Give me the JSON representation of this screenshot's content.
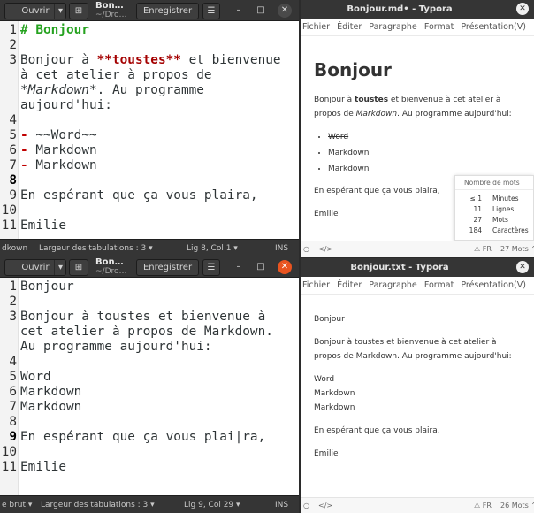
{
  "gedit_top": {
    "open_label": "Ouvrir",
    "title": "Bon…",
    "subtitle": "~/Dro…",
    "save_label": "Enregistrer",
    "lines": [
      {
        "n": "1",
        "segs": [
          {
            "t": "# Bonjour",
            "s": "md-h"
          }
        ]
      },
      {
        "n": "2",
        "segs": []
      },
      {
        "n": "3",
        "segs": [
          {
            "t": "Bonjour à ",
            "s": ""
          },
          {
            "t": "**toustes**",
            "s": "md-b"
          },
          {
            "t": " et bienvenue",
            "s": ""
          }
        ]
      },
      {
        "n": "",
        "segs": [
          {
            "t": "à cet atelier à propos de",
            "s": ""
          }
        ]
      },
      {
        "n": "",
        "segs": [
          {
            "t": "*Markdown*",
            "s": "md-i"
          },
          {
            "t": ". Au programme",
            "s": ""
          }
        ]
      },
      {
        "n": "",
        "segs": [
          {
            "t": "aujourd'hui:",
            "s": ""
          }
        ]
      },
      {
        "n": "4",
        "segs": []
      },
      {
        "n": "5",
        "segs": [
          {
            "t": "-",
            "s": "md-li"
          },
          {
            "t": " ~~Word~~",
            "s": ""
          }
        ]
      },
      {
        "n": "6",
        "segs": [
          {
            "t": "-",
            "s": "md-li"
          },
          {
            "t": " Markdown",
            "s": ""
          }
        ]
      },
      {
        "n": "7",
        "segs": [
          {
            "t": "-",
            "s": "md-li"
          },
          {
            "t": " Markdown",
            "s": ""
          }
        ]
      },
      {
        "n": "8",
        "segs": [],
        "cur": true
      },
      {
        "n": "9",
        "segs": [
          {
            "t": "En espérant que ça vous plaira,",
            "s": ""
          }
        ]
      },
      {
        "n": "10",
        "segs": []
      },
      {
        "n": "11",
        "segs": [
          {
            "t": "Emilie",
            "s": ""
          }
        ]
      }
    ],
    "status_lang": "dkown",
    "status_tabs": "Largeur des tabulations : 3",
    "status_pos": "Lig 8, Col 1",
    "status_ins": "INS"
  },
  "gedit_bot": {
    "open_label": "Ouvrir",
    "title": "Bon…",
    "subtitle": "~/Dro…",
    "save_label": "Enregistrer",
    "lines": [
      {
        "n": "1",
        "segs": [
          {
            "t": "Bonjour",
            "s": ""
          }
        ]
      },
      {
        "n": "2",
        "segs": []
      },
      {
        "n": "3",
        "segs": [
          {
            "t": "Bonjour à toustes et bienvenue à",
            "s": ""
          }
        ]
      },
      {
        "n": "",
        "segs": [
          {
            "t": "cet atelier à propos de Markdown.",
            "s": ""
          }
        ]
      },
      {
        "n": "",
        "segs": [
          {
            "t": "Au programme aujourd'hui:",
            "s": ""
          }
        ]
      },
      {
        "n": "4",
        "segs": []
      },
      {
        "n": "5",
        "segs": [
          {
            "t": "Word",
            "s": ""
          }
        ]
      },
      {
        "n": "6",
        "segs": [
          {
            "t": "Markdown",
            "s": ""
          }
        ]
      },
      {
        "n": "7",
        "segs": [
          {
            "t": "Markdown",
            "s": ""
          }
        ]
      },
      {
        "n": "8",
        "segs": []
      },
      {
        "n": "9",
        "segs": [
          {
            "t": "En espérant que ça vous plai|ra,",
            "s": ""
          }
        ],
        "cur": true
      },
      {
        "n": "10",
        "segs": []
      },
      {
        "n": "11",
        "segs": [
          {
            "t": "Emilie",
            "s": ""
          }
        ]
      }
    ],
    "status_lang": "e brut",
    "status_tabs": "Largeur des tabulations : 3",
    "status_pos": "Lig 9, Col 29",
    "status_ins": "INS"
  },
  "typora_top": {
    "title": "Bonjour.md• - Typora",
    "menu": [
      "Fichier",
      "Éditer",
      "Paragraphe",
      "Format",
      "Présentation(V)"
    ],
    "heading": "Bonjour",
    "p1_pre": "Bonjour à ",
    "p1_bold": "toustes",
    "p1_mid": " et bienvenue à cet atelier à propos de ",
    "p1_it": "Markdown",
    "p1_post": ". Au programme aujourd'hui:",
    "items": [
      "Word",
      "Markdown",
      "Markdown"
    ],
    "p2": "En espérant que ça vous plaira,",
    "p3": "Emilie",
    "wordcount": {
      "header": "Nombre de mots",
      "rows": [
        {
          "v": "≤ 1",
          "l": "Minutes"
        },
        {
          "v": "11",
          "l": "Lignes"
        },
        {
          "v": "27",
          "l": "Mots"
        },
        {
          "v": "184",
          "l": "Caractères"
        }
      ]
    },
    "lang": "FR",
    "words": "27 Mots"
  },
  "typora_bot": {
    "title": "Bonjour.txt - Typora",
    "menu": [
      "Fichier",
      "Éditer",
      "Paragraphe",
      "Format",
      "Présentation(V)"
    ],
    "p0": "Bonjour",
    "p1": "Bonjour à toustes et bienvenue à cet atelier à propos de Markdown. Au programme aujourd'hui:",
    "l1": "Word",
    "l2": "Markdown",
    "l3": "Markdown",
    "p2": "En espérant que ça vous plaira,",
    "p3": "Emilie",
    "lang": "FR",
    "words": "26 Mots"
  }
}
